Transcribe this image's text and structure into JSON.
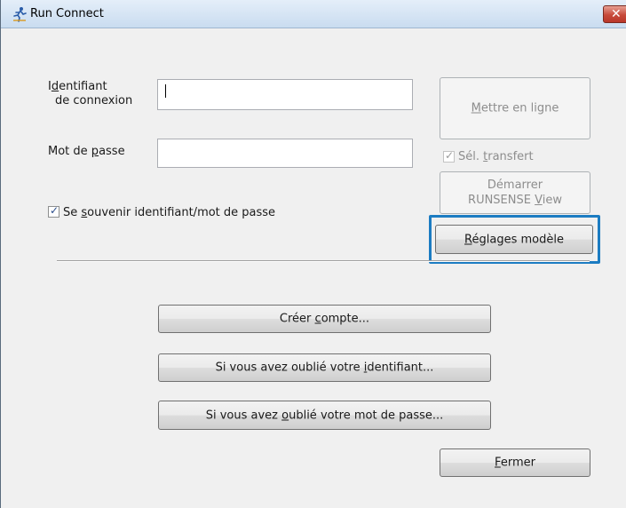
{
  "window": {
    "title": "Run Connect",
    "close_icon": "close-icon",
    "app_icon": "running-man-icon"
  },
  "login": {
    "id_label_line1_pre": "I",
    "id_label_line1_mnemonic": "d",
    "id_label_line1_post": "entifiant",
    "id_label_line2": "de connexion",
    "id_value": "",
    "password_label_pre": "Mot de ",
    "password_label_mnemonic": "p",
    "password_label_post": "asse",
    "password_value": "",
    "remember_pre": "Se ",
    "remember_mnemonic": "s",
    "remember_post": "ouvenir identifiant/mot de passe",
    "remember_checked": true
  },
  "right_panel": {
    "online_mnemonic": "M",
    "online_post": "ettre en ligne",
    "transfer_pre": "Sél. ",
    "transfer_mnemonic": "t",
    "transfer_post": "ransfert",
    "transfer_checked": true,
    "start_view_line1": "Démarrer",
    "start_view_line2_pre": "RUNSENSE ",
    "start_view_line2_mnemonic": "V",
    "start_view_line2_post": "iew",
    "model_settings_mnemonic": "R",
    "model_settings_post": "églages modèle"
  },
  "actions": {
    "create_pre": "Créer ",
    "create_mnemonic": "c",
    "create_post": "ompte...",
    "forgot_id_pre": "Si vous avez oublié votre ",
    "forgot_id_mnemonic": "i",
    "forgot_id_post": "dentifiant...",
    "forgot_pw_pre": "Si vous avez ",
    "forgot_pw_mnemonic": "o",
    "forgot_pw_post": "ublié votre mot de passe...",
    "close_mnemonic": "F",
    "close_post": "ermer"
  },
  "colors": {
    "focus_ring": "#1c7cc2",
    "close_button": "#c74a3a"
  }
}
